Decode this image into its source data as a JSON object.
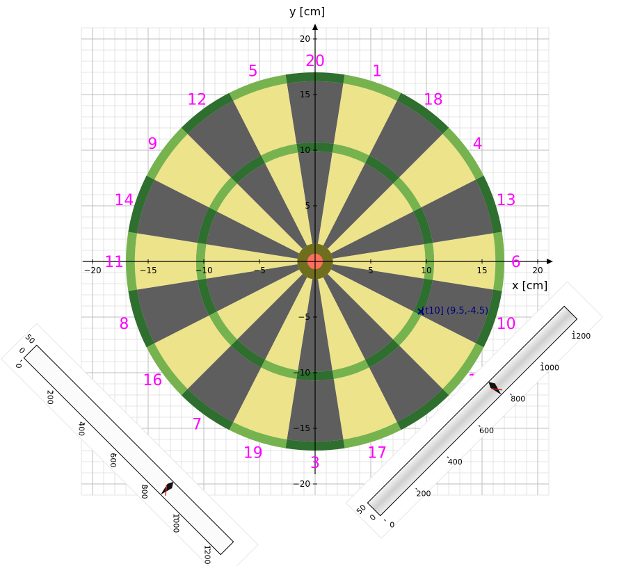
{
  "plot": {
    "x_axis_label": "x [cm]",
    "y_axis_label": "y [cm]",
    "xlim": [
      -20,
      20
    ],
    "ylim": [
      -20,
      20
    ],
    "x_ticks": [
      -20,
      -15,
      -10,
      -5,
      5,
      10,
      15,
      20
    ],
    "y_ticks": [
      -20,
      -15,
      -10,
      -5,
      5,
      10,
      15,
      20
    ],
    "x_tick_labels": [
      "−20",
      "−15",
      "−10",
      "−5",
      "5",
      "10",
      "15",
      "20"
    ],
    "y_tick_labels": [
      "−20",
      "−15",
      "−10",
      "−5",
      "5",
      "10",
      "15",
      "20"
    ],
    "grid": true,
    "minor_grid": true
  },
  "board": {
    "segment_numbers": [
      "20",
      "1",
      "18",
      "4",
      "13",
      "6",
      "10",
      "15",
      "2",
      "17",
      "3",
      "19",
      "7",
      "16",
      "8",
      "11",
      "14",
      "9",
      "12",
      "5"
    ],
    "radii_cm": {
      "bull": 0.7,
      "outer_bull": 1.6,
      "triple_inner": 9.9,
      "triple_outer": 10.7,
      "double_inner": 16.2,
      "double_outer": 17.0
    },
    "colors": {
      "dark_segment": "#5e5e5e",
      "light_segment": "#ede38a",
      "ring_light": "#76b34f",
      "ring_dark": "#2e6e2e",
      "outer_bull": "#6f6d1e",
      "bull": "#ff6f5e",
      "segment_number": "#ff00ff",
      "annotation": "#000080"
    }
  },
  "dart": {
    "marker": "x",
    "x": 9.5,
    "y": -4.5,
    "label": "[t10] (9.5,-4.5)"
  },
  "camera_left": {
    "ticks": [
      "0",
      "50",
      "0",
      "200",
      "400",
      "600",
      "800",
      "1000",
      "1200"
    ]
  },
  "camera_right": {
    "ticks": [
      "0",
      "50",
      "0",
      "200",
      "400",
      "600",
      "800",
      "1000",
      "1200"
    ]
  }
}
